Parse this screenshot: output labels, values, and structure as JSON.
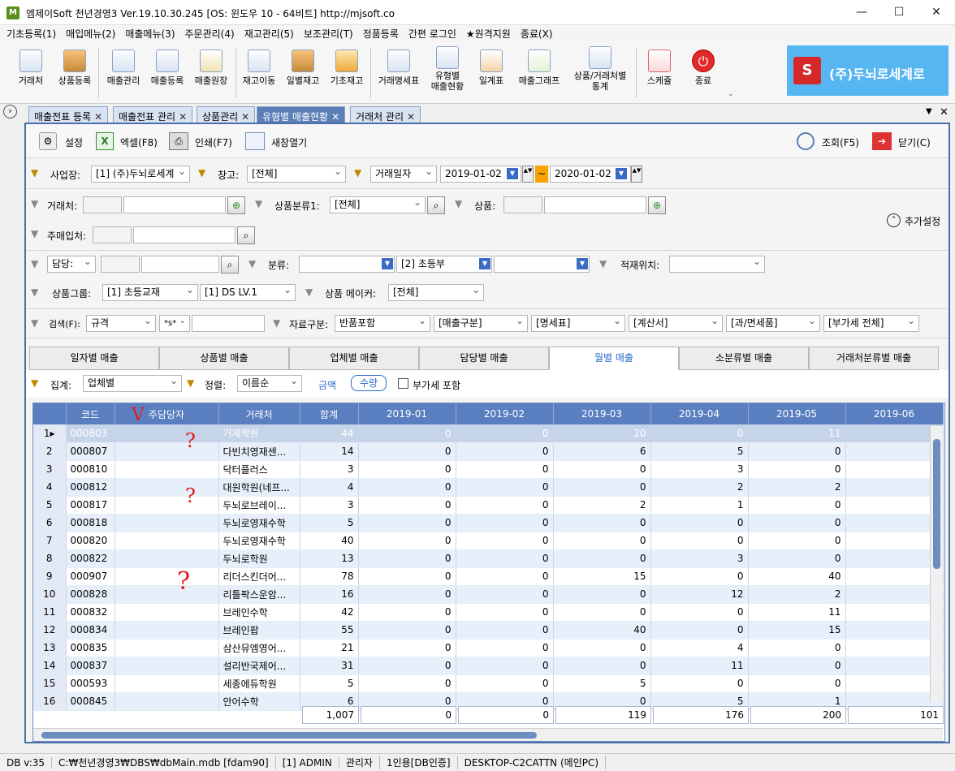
{
  "window": {
    "title": "엠제이Soft 천년경영3  Ver.19.10.30.245   [OS: 윈도우 10 - 64비트]   http://mjsoft.co"
  },
  "menu": [
    "기초등록(1)",
    "매입메뉴(2)",
    "매출메뉴(3)",
    "주문관리(4)",
    "재고관리(5)",
    "보조관리(T)",
    "정품등록",
    "간편 로그인",
    "★원격지원",
    "종료(X)"
  ],
  "toolbar": [
    {
      "label": "거래처",
      "icon": "customer-icon"
    },
    {
      "label": "상품등록",
      "icon": "boxes-icon"
    },
    {
      "label": "매출관리",
      "icon": "store-icon"
    },
    {
      "label": "매출등록",
      "icon": "store-add-icon"
    },
    {
      "label": "매출원장",
      "icon": "ledger-icon"
    },
    {
      "label": "재고이동",
      "icon": "stock-move-icon"
    },
    {
      "label": "일별재고",
      "icon": "daily-stock-icon"
    },
    {
      "label": "기초재고",
      "icon": "base-stock-icon"
    },
    {
      "label": "거래명세표",
      "icon": "invoice-icon"
    },
    {
      "label": "유형별\n매출현황",
      "icon": "sales-type-icon"
    },
    {
      "label": "일계표",
      "icon": "daily-report-icon"
    },
    {
      "label": "매출그래프",
      "icon": "chart-icon"
    },
    {
      "label": "상품/거래처별\n통계",
      "icon": "stats-icon"
    },
    {
      "label": "스케쥴",
      "icon": "calendar-icon"
    },
    {
      "label": "종료",
      "icon": "power-icon"
    }
  ],
  "brand": {
    "logo": "S",
    "text": "(주)두뇌로세계로"
  },
  "doc_tabs": [
    "매출전표 등록",
    "매출전표 관리",
    "상품관리",
    "유형별 매출현황",
    "거래처 관리"
  ],
  "actions": {
    "settings": "설정",
    "excel": "엑셀(F8)",
    "print": "인쇄(F7)",
    "new_window": "새창열기",
    "search": "조회(F5)",
    "close": "닫기(C)"
  },
  "filters": {
    "business_label": "사업장:",
    "business_value": "[1] (주)두뇌로세계",
    "warehouse_label": "창고:",
    "warehouse_value": "[전체]",
    "date_type": "거래일자",
    "date_from": "2019-01-02",
    "date_sep": "~",
    "date_to": "2020-01-02",
    "customer_label": "거래처:",
    "category_label": "상품분류1:",
    "category_value": "[전체]",
    "product_label": "상품:",
    "buyer_label": "주매입처:",
    "more_settings": "추가설정",
    "manager_label": "담당:",
    "class_label": "분류:",
    "class_value": "[2] 초등부",
    "location_label": "적재위치:",
    "group_label": "상품그룹:",
    "group_value": "[1] 초등교재",
    "group_value2": "[1] DS LV.1",
    "maker_label": "상품 메이커:",
    "maker_value": "[전체]",
    "search_label": "검색(F):",
    "search_field": "규격",
    "search_op": "*s*",
    "data_label": "자료구분:",
    "data_value": "반품포함",
    "sales_type": "[매출구분]",
    "statement": "[명세표]",
    "tax_invoice": "[계산서]",
    "taxable": "[과/면세품]",
    "vat": "[부가세 전체]"
  },
  "sub_tabs": [
    "일자별 매출",
    "상품별 매출",
    "업체별 매출",
    "담당별 매출",
    "월별 매출",
    "소분류별 매출",
    "거래처분류별 매출"
  ],
  "aggregate": {
    "label": "집계:",
    "value": "업체별",
    "sort_label": "정렬:",
    "sort_value": "이름순",
    "amount": "금액",
    "quantity": "수량",
    "vat_include": "부가세 포함"
  },
  "columns": [
    "",
    "코드",
    "주담당자",
    "거래처",
    "합계",
    "2019-01",
    "2019-02",
    "2019-03",
    "2019-04",
    "2019-05",
    "2019-06"
  ],
  "rows": [
    [
      "1",
      "000803",
      "",
      "거제학원",
      "44",
      "0",
      "0",
      "20",
      "0",
      "11",
      ""
    ],
    [
      "2",
      "000807",
      "",
      "다빈치영재센...",
      "14",
      "0",
      "0",
      "6",
      "5",
      "0",
      ""
    ],
    [
      "3",
      "000810",
      "",
      "닥터플러스",
      "3",
      "0",
      "0",
      "0",
      "3",
      "0",
      ""
    ],
    [
      "4",
      "000812",
      "",
      "대원학원(네프...",
      "4",
      "0",
      "0",
      "0",
      "2",
      "2",
      ""
    ],
    [
      "5",
      "000817",
      "",
      "두뇌로브레이...",
      "3",
      "0",
      "0",
      "2",
      "1",
      "0",
      ""
    ],
    [
      "6",
      "000818",
      "",
      "두뇌로영재수학",
      "5",
      "0",
      "0",
      "0",
      "0",
      "0",
      ""
    ],
    [
      "7",
      "000820",
      "",
      "두뇌로영재수학",
      "40",
      "0",
      "0",
      "0",
      "0",
      "0",
      ""
    ],
    [
      "8",
      "000822",
      "",
      "두뇌로학원",
      "13",
      "0",
      "0",
      "0",
      "3",
      "0",
      ""
    ],
    [
      "9",
      "000907",
      "",
      "리더스킨더어...",
      "78",
      "0",
      "0",
      "15",
      "0",
      "40",
      ""
    ],
    [
      "10",
      "000828",
      "",
      "리틀팍스운암...",
      "16",
      "0",
      "0",
      "0",
      "12",
      "2",
      ""
    ],
    [
      "11",
      "000832",
      "",
      "브레인수학",
      "42",
      "0",
      "0",
      "0",
      "0",
      "11",
      ""
    ],
    [
      "12",
      "000834",
      "",
      "브레인팝",
      "55",
      "0",
      "0",
      "40",
      "0",
      "15",
      ""
    ],
    [
      "13",
      "000835",
      "",
      "삼산뮤엠영어...",
      "21",
      "0",
      "0",
      "0",
      "4",
      "0",
      ""
    ],
    [
      "14",
      "000837",
      "",
      "설리반국제어...",
      "31",
      "0",
      "0",
      "0",
      "11",
      "0",
      ""
    ],
    [
      "15",
      "000593",
      "",
      "세종에듀학원",
      "5",
      "0",
      "0",
      "5",
      "0",
      "0",
      ""
    ],
    [
      "16",
      "000845",
      "",
      "안어수학",
      "6",
      "0",
      "0",
      "0",
      "5",
      "1",
      ""
    ]
  ],
  "totals": [
    "1,007",
    "0",
    "0",
    "119",
    "176",
    "200",
    "101"
  ],
  "status": [
    "DB v:35",
    "C:₩천년경영3₩DBS₩dbMain.mdb [fdam90]",
    "[1] ADMIN",
    "관리자",
    "1인용[DB인증]",
    "DESKTOP-C2CATTN (메인PC)"
  ],
  "annotations": [
    "V",
    "?",
    "?",
    "?"
  ]
}
